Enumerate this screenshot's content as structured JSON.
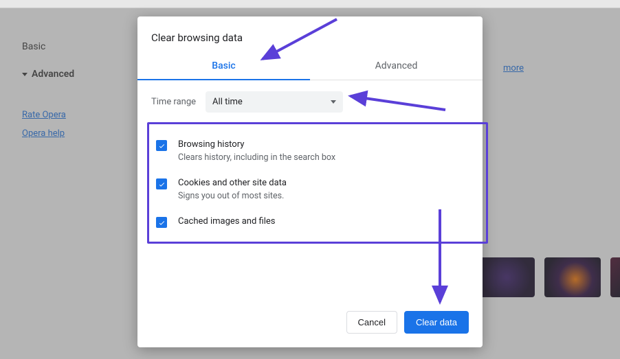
{
  "sidebar": {
    "basic": "Basic",
    "advanced": "Advanced",
    "rate_link": "Rate Opera",
    "help_link": "Opera help"
  },
  "bg": {
    "learn_more": "more"
  },
  "dialog": {
    "title": "Clear browsing data",
    "tabs": {
      "basic": "Basic",
      "advanced": "Advanced"
    },
    "time_range_label": "Time range",
    "time_range_value": "All time",
    "options": [
      {
        "title": "Browsing history",
        "desc": "Clears history, including in the search box"
      },
      {
        "title": "Cookies and other site data",
        "desc": "Signs you out of most sites."
      },
      {
        "title": "Cached images and files",
        "desc": ""
      }
    ],
    "cancel": "Cancel",
    "clear": "Clear data"
  },
  "annotation": {
    "color": "#5a3fd8"
  }
}
